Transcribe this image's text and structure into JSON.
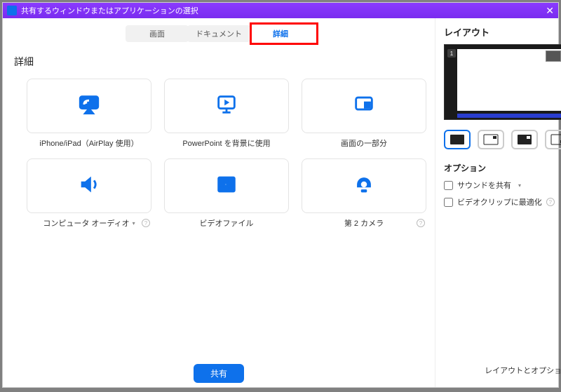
{
  "window": {
    "title": "共有するウィンドウまたはアプリケーションの選択"
  },
  "tabs": {
    "screen": "画面",
    "document": "ドキュメント",
    "detail": "詳細"
  },
  "section": {
    "title": "詳細"
  },
  "cards": {
    "airplay": "iPhone/iPad（AirPlay 使用）",
    "ppt": "PowerPoint を背景に使用",
    "portion": "画面の一部分",
    "audio": "コンピュータ オーディオ",
    "video": "ビデオファイル",
    "camera2": "第 2 カメラ"
  },
  "share_button": "共有",
  "side": {
    "layout_title": "レイアウト",
    "options_title": "オプション",
    "opt_sound": "サウンドを共有",
    "opt_video": "ビデオクリップに最適化",
    "footer": "レイアウトとオプション",
    "preview_badge": "1"
  }
}
